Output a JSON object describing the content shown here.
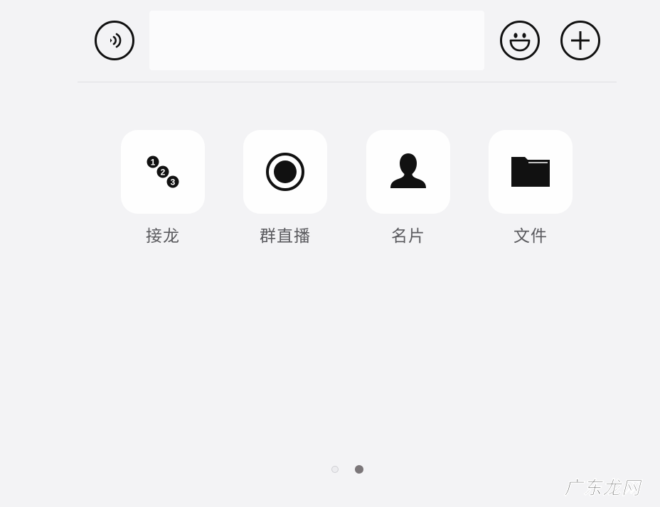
{
  "input_bar": {
    "voice_icon": "voice-icon",
    "text_value": "",
    "emoji_icon": "smiley-icon",
    "more_icon": "plus-circle-icon"
  },
  "tools": [
    {
      "label": "接龙",
      "icon": "numbered-sequence-icon"
    },
    {
      "label": "群直播",
      "icon": "live-broadcast-icon"
    },
    {
      "label": "名片",
      "icon": "contact-card-icon"
    },
    {
      "label": "文件",
      "icon": "folder-icon"
    }
  ],
  "pager": {
    "page_count": 2,
    "current_page": 2
  },
  "watermark": {
    "text": "广东龙网"
  },
  "colors": {
    "background": "#f3f3f5",
    "tile": "#fefefe",
    "label": "#5a5a5e",
    "icon": "#111111",
    "active_dot": "#7b7679"
  }
}
